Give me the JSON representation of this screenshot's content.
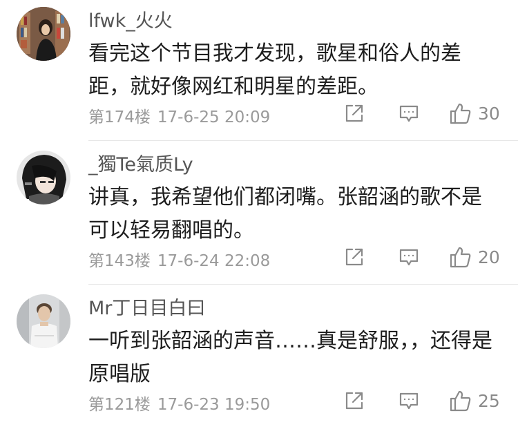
{
  "comments": [
    {
      "username": "lfwk_火火",
      "lines": [
        "看完这个节目我才发现，歌星和俗人的差",
        "距，就好像网红和明星的差距。"
      ],
      "floor": "第174楼",
      "time": "17-6-25 20:09",
      "likes": "30",
      "avatar_icon": "avatar-bookstore-photo"
    },
    {
      "username": "_獨Te氣质Ly",
      "lines": [
        "讲真，我希望他们都闭嘴。张韶涵的歌不是",
        "可以轻易翻唱的。"
      ],
      "floor": "第143楼",
      "time": "17-6-24 22:08",
      "likes": "20",
      "avatar_icon": "avatar-dark-hair-photo"
    },
    {
      "username": "Mr丁日目白曰",
      "lines": [
        "一听到张韶涵的声音……真是舒服，，还得是",
        "原唱版"
      ],
      "floor": "第121楼",
      "time": "17-6-23 19:50",
      "likes": "25",
      "avatar_icon": "avatar-man-photo"
    }
  ],
  "icons": {
    "share": "share-icon",
    "reply": "reply-icon",
    "like": "thumbs-up-icon"
  },
  "colors": {
    "username": "#555555",
    "meta": "#9a9a9a",
    "icon": "#8a8a8a",
    "divider": "#e6e6e6"
  }
}
